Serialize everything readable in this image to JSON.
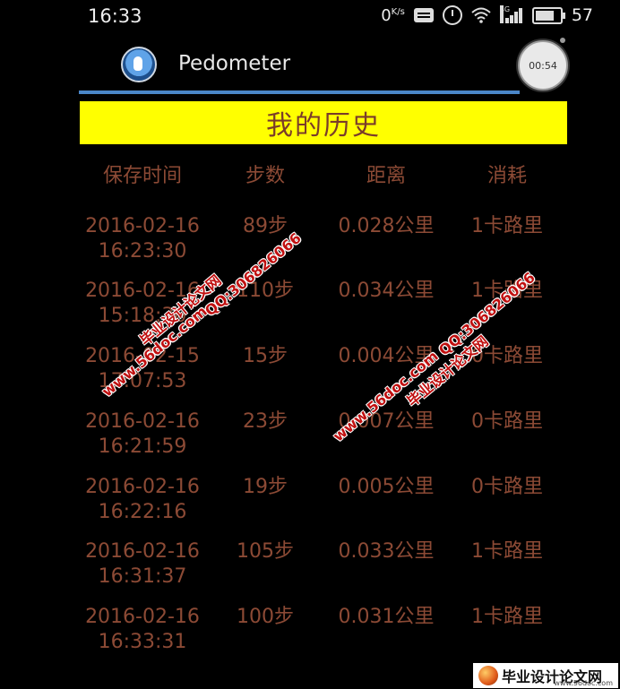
{
  "status_bar": {
    "time": "16:33",
    "net_speed": "0",
    "net_unit": "K/s",
    "signal_label": "4G",
    "battery": "57"
  },
  "app_bar": {
    "title": "Pedometer",
    "timer": "00:54",
    "accent_color": "#4a86c8"
  },
  "page": {
    "title": "我的历史",
    "banner_color": "#ffff00",
    "text_color": "#8c4a35"
  },
  "table": {
    "headers": [
      "保存时间",
      "步数",
      "距离",
      "消耗"
    ],
    "rows": [
      {
        "time": "2016-02-16\n16:23:30",
        "steps": "89步",
        "distance": "0.028公里",
        "calories": "1卡路里"
      },
      {
        "time": "2016-02-16\n15:18:30",
        "steps": "110步",
        "distance": "0.034公里",
        "calories": "1卡路里"
      },
      {
        "time": "2016-02-15\n17:07:53",
        "steps": "15步",
        "distance": "0.004公里",
        "calories": "0卡路里"
      },
      {
        "time": "2016-02-16\n16:21:59",
        "steps": "23步",
        "distance": "0.007公里",
        "calories": "0卡路里"
      },
      {
        "time": "2016-02-16\n16:22:16",
        "steps": "19步",
        "distance": "0.005公里",
        "calories": "0卡路里"
      },
      {
        "time": "2016-02-16\n16:31:37",
        "steps": "105步",
        "distance": "0.033公里",
        "calories": "1卡路里"
      },
      {
        "time": "2016-02-16\n16:33:31",
        "steps": "100步",
        "distance": "0.031公里",
        "calories": "1卡路里"
      }
    ]
  },
  "watermarks": {
    "site_name": "毕业设计论文网",
    "site_url": "www.56doc.com",
    "qq": "QQ:306826066"
  },
  "footer": {
    "logo_text": "毕业设计论文网",
    "logo_url": "www.56doc.com"
  }
}
